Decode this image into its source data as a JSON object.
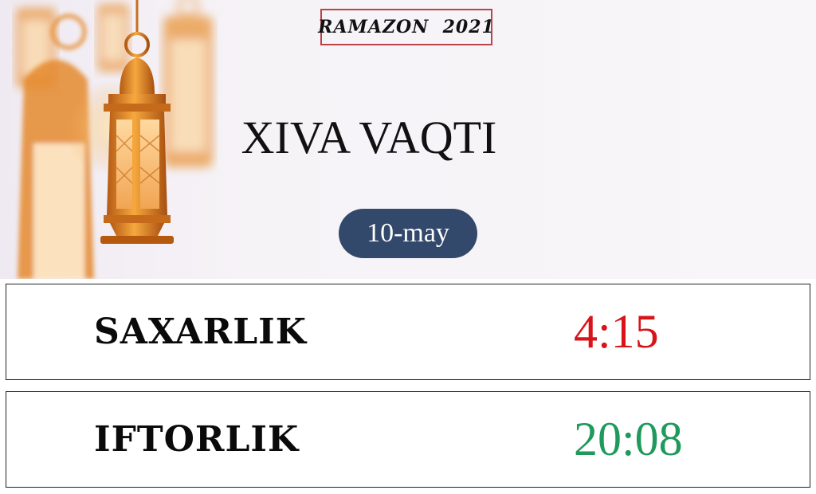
{
  "header": {
    "badge": "RAMAZON  2021",
    "title": "XIVA VAQTI",
    "date": "10-may"
  },
  "rows": [
    {
      "label": "SAXARLIK",
      "time": "4:15",
      "color": "#d8141a"
    },
    {
      "label": "IFTORLIK",
      "time": "20:08",
      "color": "#1f9a5c"
    }
  ],
  "decoration": {
    "icon": "lantern-icon",
    "accent": "#e89a2c"
  }
}
